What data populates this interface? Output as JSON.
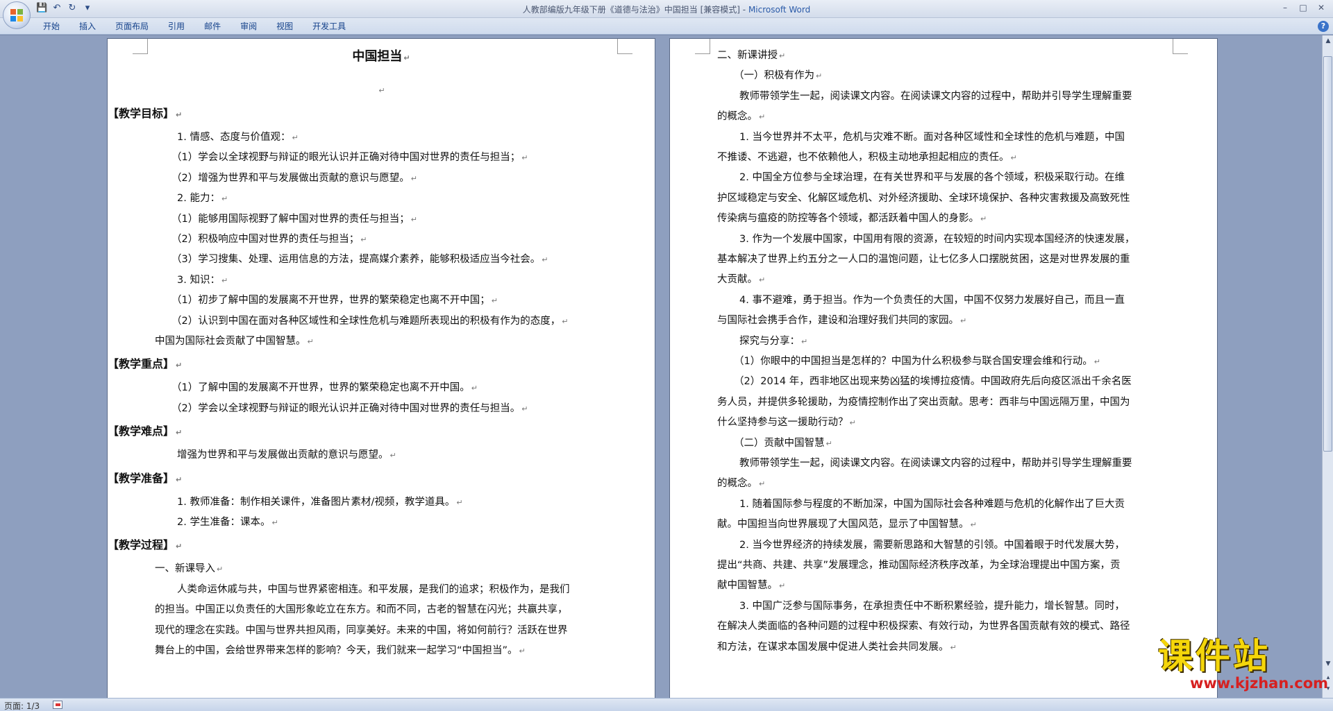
{
  "window": {
    "title": "人教部编版九年级下册《道德与法治》中国担当 [兼容模式]",
    "app_name": "Microsoft Word"
  },
  "ribbon": {
    "tabs": [
      "开始",
      "插入",
      "页面布局",
      "引用",
      "邮件",
      "审阅",
      "视图",
      "开发工具"
    ]
  },
  "status": {
    "page": "页面: 1/3"
  },
  "watermark": {
    "title": "课件站",
    "url": "www.kjzhan.com"
  },
  "paragraph_mark": "↵",
  "page_left": {
    "lines": [
      {
        "text": "中国担当",
        "style": "title"
      },
      {
        "text": "",
        "style": "empty"
      },
      {
        "text": "【教学目标】",
        "style": "heading"
      },
      {
        "text": "1. 情感、态度与价值观：",
        "style": "i2"
      },
      {
        "text": "（1）学会以全球视野与辩证的眼光认识并正确对待中国对世界的责任与担当；",
        "style": "i1"
      },
      {
        "text": "（2）增强为世界和平与发展做出贡献的意识与愿望。",
        "style": "i1"
      },
      {
        "text": "2. 能力：",
        "style": "i2"
      },
      {
        "text": "（1）能够用国际视野了解中国对世界的责任与担当；",
        "style": "i1"
      },
      {
        "text": "（2）积极响应中国对世界的责任与担当；",
        "style": "i1"
      },
      {
        "text": "（3）学习搜集、处理、运用信息的方法，提高媒介素养，能够积极适应当今社会。",
        "style": "i1"
      },
      {
        "text": "3. 知识：",
        "style": "i2"
      },
      {
        "text": "（1）初步了解中国的发展离不开世界，世界的繁荣稳定也离不开中国；",
        "style": "i1"
      },
      {
        "text": "（2）认识到中国在面对各种区域性和全球性危机与难题所表现出的积极有作为的态度，",
        "style": "i1"
      },
      {
        "text": "中国为国际社会贡献了中国智慧。",
        "style": "i0"
      },
      {
        "text": "【教学重点】",
        "style": "heading"
      },
      {
        "text": "（1）了解中国的发展离不开世界，世界的繁荣稳定也离不开中国。",
        "style": "i1"
      },
      {
        "text": "（2）学会以全球视野与辩证的眼光认识并正确对待中国对世界的责任与担当。",
        "style": "i1"
      },
      {
        "text": "【教学难点】",
        "style": "heading"
      },
      {
        "text": "增强为世界和平与发展做出贡献的意识与愿望。",
        "style": "i2"
      },
      {
        "text": "【教学准备】",
        "style": "heading"
      },
      {
        "text": "1. 教师准备：制作相关课件，准备图片素材/视频，教学道具。",
        "style": "i2"
      },
      {
        "text": "2. 学生准备：课本。",
        "style": "i2"
      },
      {
        "text": "【教学过程】",
        "style": "heading"
      },
      {
        "text": "一、新课导入",
        "style": "i0"
      },
      {
        "text": "人类命运休戚与共，中国与世界紧密相连。和平发展，是我们的追求；积极作为，是我们",
        "style": "i2",
        "nomark": true
      },
      {
        "text": "的担当。中国正以负责任的大国形象屹立在东方。和而不同，古老的智慧在闪光；共赢共享，",
        "style": "i0",
        "nomark": true
      },
      {
        "text": "现代的理念在实践。中国与世界共担风雨，同享美好。未来的中国，将如何前行？活跃在世界",
        "style": "i0",
        "nomark": true
      },
      {
        "text": "舞台上的中国，会给世界带来怎样的影响？今天，我们就来一起学习“中国担当”。",
        "style": "i0"
      }
    ]
  },
  "page_right": {
    "lines": [
      {
        "text": "二、新课讲授",
        "style": "i0"
      },
      {
        "text": "（一）积极有作为",
        "style": "i1"
      },
      {
        "text": "教师带领学生一起，阅读课文内容。在阅读课文内容的过程中，帮助并引导学生理解重要",
        "style": "i2",
        "nomark": true
      },
      {
        "text": "的概念。",
        "style": "i0"
      },
      {
        "text": "1. 当今世界并不太平，危机与灾难不断。面对各种区域性和全球性的危机与难题，中国",
        "style": "i2",
        "nomark": true
      },
      {
        "text": "不推诿、不逃避，也不依赖他人，积极主动地承担起相应的责任。",
        "style": "i0"
      },
      {
        "text": "2. 中国全方位参与全球治理，在有关世界和平与发展的各个领域，积极采取行动。在维",
        "style": "i2",
        "nomark": true
      },
      {
        "text": "护区域稳定与安全、化解区域危机、对外经济援助、全球环境保护、各种灾害救援及高致死性",
        "style": "i0",
        "nomark": true
      },
      {
        "text": "传染病与瘟疫的防控等各个领域，都活跃着中国人的身影。",
        "style": "i0"
      },
      {
        "text": "3. 作为一个发展中国家，中国用有限的资源，在较短的时间内实现本国经济的快速发展，",
        "style": "i2",
        "nomark": true
      },
      {
        "text": "基本解决了世界上约五分之一人口的温饱问题，让七亿多人口摆脱贫困，这是对世界发展的重",
        "style": "i0",
        "nomark": true
      },
      {
        "text": "大贡献。",
        "style": "i0"
      },
      {
        "text": "4. 事不避难，勇于担当。作为一个负责任的大国，中国不仅努力发展好自己，而且一直",
        "style": "i2",
        "nomark": true
      },
      {
        "text": "与国际社会携手合作，建设和治理好我们共同的家园。",
        "style": "i0"
      },
      {
        "text": "探究与分享：",
        "style": "i2"
      },
      {
        "text": "（1）你眼中的中国担当是怎样的？中国为什么积极参与联合国安理会维和行动。",
        "style": "i1"
      },
      {
        "text": "（2）2014 年，西非地区出现来势凶猛的埃博拉疫情。中国政府先后向疫区派出千余名医",
        "style": "i1",
        "nomark": true
      },
      {
        "text": "务人员，并提供多轮援助，为疫情控制作出了突出贡献。思考：西非与中国远隔万里，中国为",
        "style": "i0",
        "nomark": true
      },
      {
        "text": "什么坚持参与这一援助行动？",
        "style": "i0"
      },
      {
        "text": "（二）贡献中国智慧",
        "style": "i1"
      },
      {
        "text": "教师带领学生一起，阅读课文内容。在阅读课文内容的过程中，帮助并引导学生理解重要",
        "style": "i2",
        "nomark": true
      },
      {
        "text": "的概念。",
        "style": "i0"
      },
      {
        "text": "1. 随着国际参与程度的不断加深，中国为国际社会各种难题与危机的化解作出了巨大贡",
        "style": "i2",
        "nomark": true
      },
      {
        "text": "献。中国担当向世界展现了大国风范，显示了中国智慧。",
        "style": "i0"
      },
      {
        "text": "2. 当今世界经济的持续发展，需要新思路和大智慧的引领。中国着眼于时代发展大势，",
        "style": "i2",
        "nomark": true
      },
      {
        "text": "提出“共商、共建、共享”发展理念，推动国际经济秩序改革，为全球治理提出中国方案，贡",
        "style": "i0",
        "nomark": true
      },
      {
        "text": "献中国智慧。",
        "style": "i0"
      },
      {
        "text": "3. 中国广泛参与国际事务，在承担责任中不断积累经验，提升能力，增长智慧。同时，",
        "style": "i2",
        "nomark": true
      },
      {
        "text": "在解决人类面临的各种问题的过程中积极探索、有效行动，为世界各国贡献有效的模式、路径",
        "style": "i0",
        "nomark": true
      },
      {
        "text": "和方法，在谋求本国发展中促进人类社会共同发展。",
        "style": "i0"
      }
    ]
  }
}
